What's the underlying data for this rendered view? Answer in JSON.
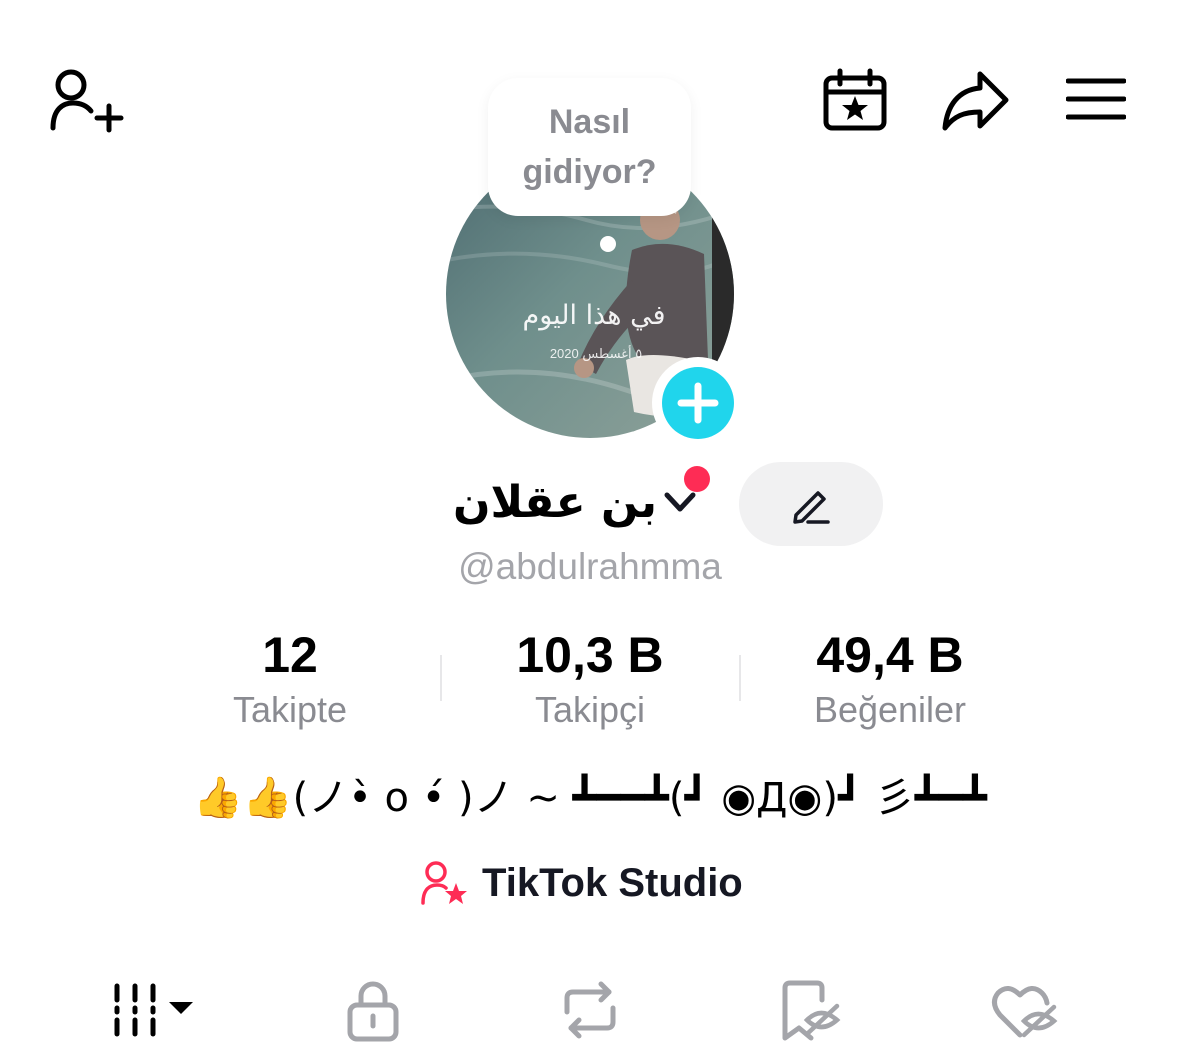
{
  "header": {
    "add_friend_icon": "person-plus-icon",
    "calendar_icon": "calendar-star-icon",
    "share_icon": "share-arrow-icon",
    "menu_icon": "hamburger-menu-icon"
  },
  "avatar": {
    "bubble_line1": "Nasıl",
    "bubble_line2": "gidiyor?",
    "overlay_text": "في هذا اليوم",
    "overlay_date": "٥ أغسطس 2020",
    "add_icon": "plus-icon"
  },
  "profile": {
    "display_name": "بن عقلان",
    "username": "@abdulrahmma",
    "edit_icon": "pencil-icon",
    "notification_color": "#fe2c55"
  },
  "stats": [
    {
      "value": "12",
      "label": "Takipte"
    },
    {
      "value": "10,3 B",
      "label": "Takipçi"
    },
    {
      "value": "49,4 B",
      "label": "Beğeniler"
    }
  ],
  "bio": "👍👍(ノ•̀ o •́ )ノ ~ ┻━━┻(┛ ◉Д◉)┛ 彡┻━┻",
  "studio": {
    "label": "TikTok Studio",
    "icon": "person-star-icon",
    "accent": "#fe2c55"
  },
  "tabs": [
    {
      "name": "videos",
      "icon": "grid-dropdown-icon"
    },
    {
      "name": "private",
      "icon": "lock-icon"
    },
    {
      "name": "reposts",
      "icon": "repost-icon"
    },
    {
      "name": "favorites",
      "icon": "bookmark-hidden-icon"
    },
    {
      "name": "liked",
      "icon": "heart-hidden-icon"
    }
  ]
}
